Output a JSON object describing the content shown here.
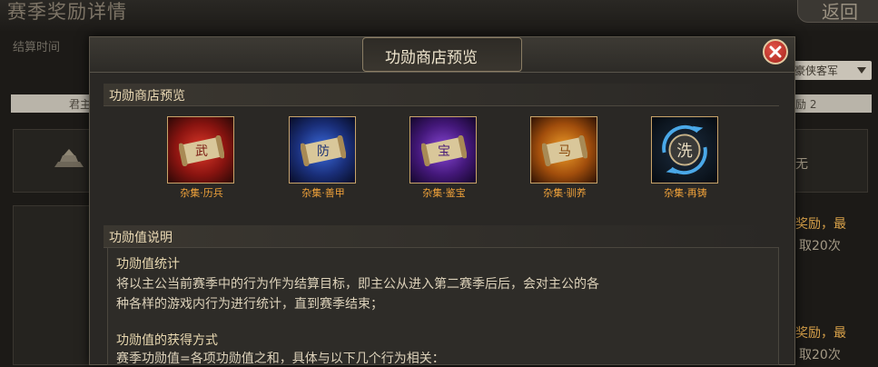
{
  "background": {
    "page_title": "赛季奖励详情",
    "back_button": "返回",
    "settle_time_label": "结算时间",
    "filter_select": "豪侠客军",
    "tab_left": "君主",
    "tab_right": "励 2",
    "side_texts": [
      "无",
      "奖励，最",
      "取20次",
      "奖励，最",
      "取20次"
    ]
  },
  "modal": {
    "title": "功勋商店预览",
    "shop_section_title": "功勋商店预览",
    "items": [
      {
        "label": "杂集·历兵",
        "glyph": "武",
        "icon": "scroll-wu-icon",
        "color": "#b3221b"
      },
      {
        "label": "杂集·善甲",
        "glyph": "防",
        "icon": "scroll-fang-icon",
        "color": "#1f3d8c"
      },
      {
        "label": "杂集·鉴宝",
        "glyph": "宝",
        "icon": "scroll-bao-icon",
        "color": "#5a2790"
      },
      {
        "label": "杂集·驯养",
        "glyph": "马",
        "icon": "scroll-ma-icon",
        "color": "#c96b12"
      },
      {
        "label": "杂集·再铸",
        "glyph": "洗",
        "icon": "recast-icon",
        "color": "#2a6da8"
      }
    ],
    "desc_section_title": "功勋值说明",
    "desc": {
      "stat_heading": "功勋值统计",
      "stat_line1": "将以主公当前赛季中的行为作为结算目标，即主公从进入第二赛季后后，会对主公的各",
      "stat_line2": "种各样的游戏内行为进行统计，直到赛季结束；",
      "gain_heading": "功勋值的获得方式",
      "gain_line1": "赛季功勋值=各项功勋值之和，具体与以下几个行为相关："
    }
  }
}
